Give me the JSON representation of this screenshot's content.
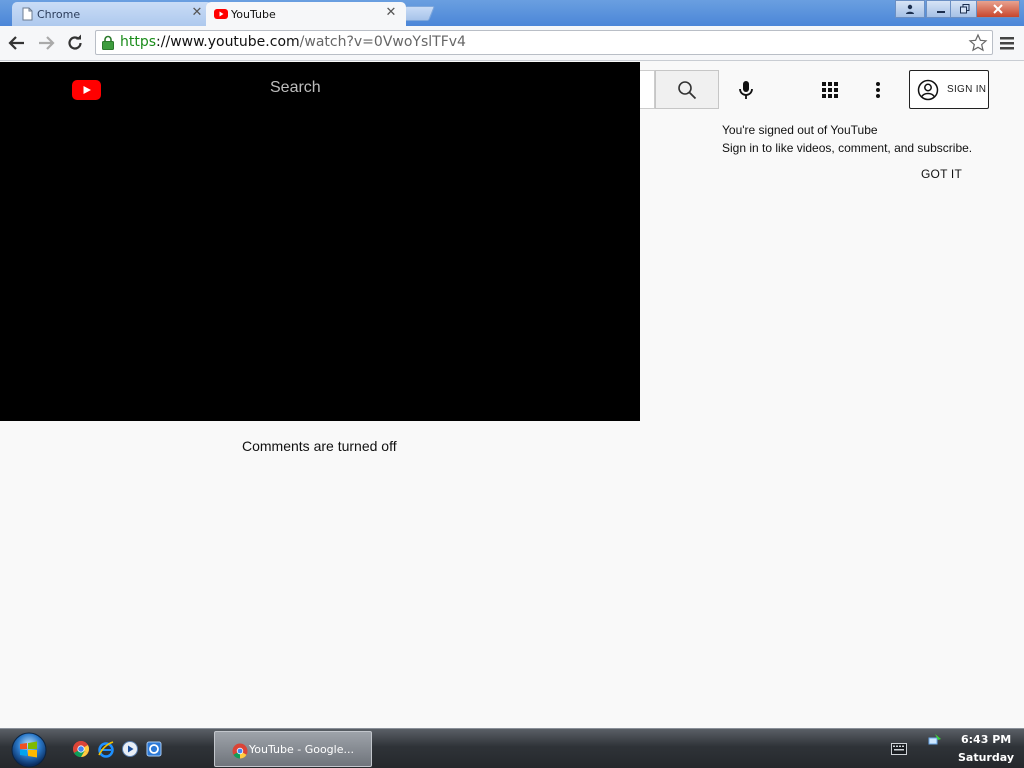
{
  "browser": {
    "tabs": [
      {
        "label": "Chrome",
        "active": false
      },
      {
        "label": "YouTube",
        "active": true
      }
    ],
    "address": {
      "scheme": "https",
      "host": "://www.youtube.com",
      "path": "/watch?v=0VwoYslTFv4"
    }
  },
  "youtube": {
    "search_placeholder": "Search",
    "sign_in_label": "SIGN IN",
    "signed_out_title": "You're signed out of YouTube",
    "signed_out_body": "Sign in to like videos, comment, and subscribe.",
    "got_it_label": "GOT IT",
    "comments_status": "Comments are turned off"
  },
  "taskbar": {
    "active_window_label": "YouTube - Google...",
    "clock_time": "6:43 PM",
    "clock_day": "Saturday"
  },
  "colors": {
    "youtube_red": "#ff0000",
    "tabstrip_blue": "#4b86d8",
    "secure_green": "#1a8c1a"
  },
  "icons": {
    "tab_inactive": "page-icon",
    "tab_active": "youtube-icon",
    "nav": [
      "back-arrow-icon",
      "forward-arrow-icon",
      "reload-icon"
    ],
    "omnibox": [
      "lock-icon",
      "star-icon"
    ],
    "youtube_header": [
      "youtube-logo",
      "search-icon",
      "microphone-icon",
      "apps-grid-icon",
      "more-vert-icon",
      "account-circle-icon"
    ],
    "taskbar": [
      "windows-start-icon",
      "chrome-icon",
      "internet-explorer-icon",
      "media-player-icon",
      "ie-alt-icon"
    ]
  }
}
